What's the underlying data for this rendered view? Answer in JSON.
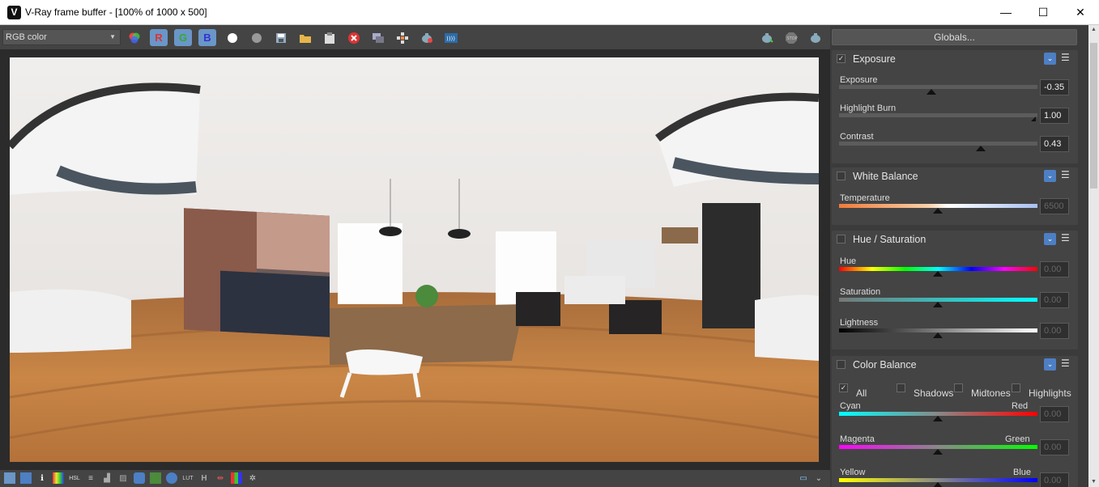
{
  "window": {
    "title": "V-Ray frame buffer - [100% of 1000 x 500]",
    "app_icon": "vray-logo-icon"
  },
  "window_controls": {
    "minimize": "—",
    "maximize": "☐",
    "close": "✕"
  },
  "toolbar": {
    "channel_select": "RGB color",
    "r_label": "R",
    "g_label": "G",
    "b_label": "B"
  },
  "panel": {
    "globals_label": "Globals...",
    "exposure": {
      "title": "Exposure",
      "enabled": true,
      "params": [
        {
          "label": "Exposure",
          "value": "-0.35",
          "pos": 0.47
        },
        {
          "label": "Highlight Burn",
          "value": "1.00",
          "pos": 1.0
        },
        {
          "label": "Contrast",
          "value": "0.43",
          "pos": 0.71
        }
      ]
    },
    "white_balance": {
      "title": "White Balance",
      "enabled": false,
      "params": [
        {
          "label": "Temperature",
          "value": "6500",
          "pos": 0.5
        }
      ]
    },
    "hue_saturation": {
      "title": "Hue / Saturation",
      "enabled": false,
      "params": [
        {
          "label": "Hue",
          "value": "0.00",
          "pos": 0.5
        },
        {
          "label": "Saturation",
          "value": "0.00",
          "pos": 0.5
        },
        {
          "label": "Lightness",
          "value": "0.00",
          "pos": 0.5
        }
      ]
    },
    "color_balance": {
      "title": "Color Balance",
      "enabled": false,
      "options": [
        "All",
        "Shadows",
        "Midtones",
        "Highlights"
      ],
      "params": [
        {
          "left": "Cyan",
          "right": "Red",
          "value": "0.00",
          "pos": 0.5
        },
        {
          "left": "Magenta",
          "right": "Green",
          "value": "0.00",
          "pos": 0.5
        },
        {
          "left": "Yellow",
          "right": "Blue",
          "value": "0.00",
          "pos": 0.5
        }
      ]
    }
  },
  "colors": {
    "accent": "#4d7fc4",
    "panel_bg": "#444444",
    "viewport_bg": "#2b2b2b"
  }
}
